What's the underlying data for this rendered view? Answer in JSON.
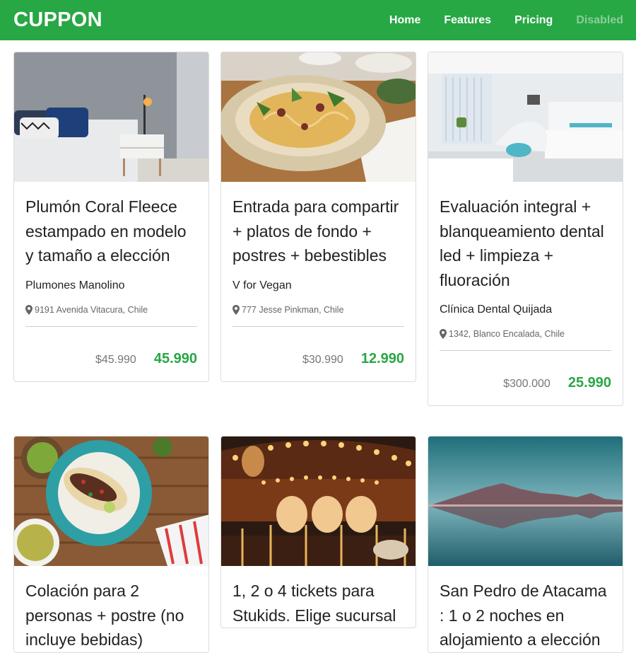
{
  "navbar": {
    "brand": "CUPPON",
    "links": [
      {
        "label": "Home"
      },
      {
        "label": "Features"
      },
      {
        "label": "Pricing"
      },
      {
        "label": "Disabled"
      }
    ]
  },
  "cards": [
    {
      "title": "Plumón Coral Fleece estampado en modelo y tamaño a elección",
      "merchant": "Plumones Manolino",
      "address": "9191 Avenida Vitacura, Chile",
      "old_price": "$45.990",
      "new_price": "45.990",
      "image": "bedroom-photo"
    },
    {
      "title": "Entrada para compartir + platos de fondo + postres + bebestibles",
      "merchant": "V for Vegan",
      "address": "777 Jesse Pinkman, Chile",
      "old_price": "$30.990",
      "new_price": "12.990",
      "image": "pasta-dish-photo"
    },
    {
      "title": "Evaluación integral + blanqueamiento dental led + limpieza + fluoración",
      "merchant": "Clínica Dental Quijada",
      "address": "1342, Blanco Encalada, Chile",
      "old_price": "$300.000",
      "new_price": "25.990",
      "image": "dental-clinic-photo"
    },
    {
      "title": "Colación para 2 personas + postre (no incluye bebidas)",
      "image": "tacos-photo"
    },
    {
      "title": "1, 2 o 4 tickets para Stukids. Elige sucursal",
      "image": "carousel-photo"
    },
    {
      "title": "San Pedro de Atacama : 1 o 2 noches en alojamiento a elección",
      "image": "volcano-lake-photo"
    }
  ],
  "colors": {
    "brand_green": "#28a745",
    "old_price_gray": "#777777"
  },
  "icons": {
    "address": "map-pin-icon"
  }
}
